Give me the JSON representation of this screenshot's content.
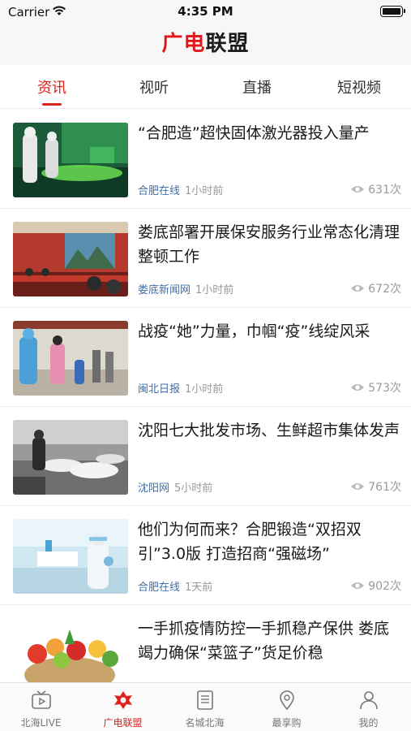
{
  "status": {
    "carrier": "Carrier",
    "time": "4:35 PM"
  },
  "header": {
    "logo_part1": "广电",
    "logo_part2": "联盟"
  },
  "tabs": [
    {
      "label": "资讯"
    },
    {
      "label": "视听"
    },
    {
      "label": "直播"
    },
    {
      "label": "短视频"
    }
  ],
  "articles": [
    {
      "title": "“合肥造”超快固体激光器投入量产",
      "source": "合肥在线",
      "time": "1小时前",
      "views": "631次"
    },
    {
      "title": "娄底部署开展保安服务行业常态化清理整顿工作",
      "source": "娄底新闻网",
      "time": "1小时前",
      "views": "672次"
    },
    {
      "title": "战疫“她”力量，巾帼“疫”线绽风采",
      "source": "闽北日报",
      "time": "1小时前",
      "views": "573次"
    },
    {
      "title": "沈阳七大批发市场、生鲜超市集体发声",
      "source": "沈阳网",
      "time": "5小时前",
      "views": "761次"
    },
    {
      "title": "他们为何而来？合肥锻造“双招双引”3.0版 打造招商“强磁场”",
      "source": "合肥在线",
      "time": "1天前",
      "views": "902次"
    },
    {
      "title": "一手抓疫情防控一手抓稳产保供 娄底竭力确保“菜篮子”货足价稳",
      "source": "",
      "time": "",
      "views": ""
    }
  ],
  "tabbar": [
    {
      "label": "北海LIVE",
      "icon": "tv-icon"
    },
    {
      "label": "广电联盟",
      "icon": "alliance-icon"
    },
    {
      "label": "名城北海",
      "icon": "document-icon"
    },
    {
      "label": "最享购",
      "icon": "location-icon"
    },
    {
      "label": "我的",
      "icon": "person-icon"
    }
  ],
  "colors": {
    "accent": "#e0211c",
    "source": "#3f6ea8",
    "muted": "#999999"
  }
}
